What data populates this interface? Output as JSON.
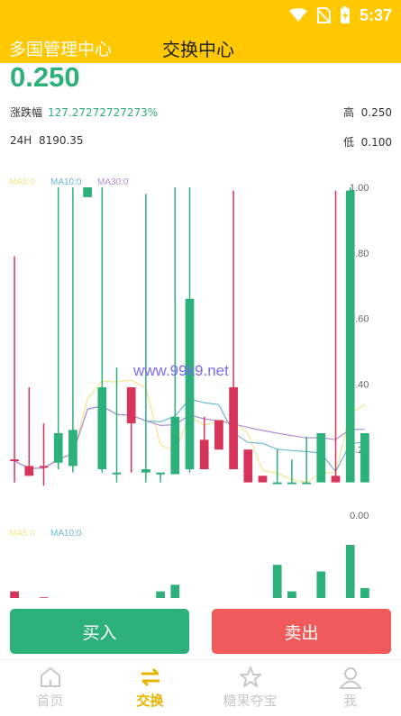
{
  "status_bar": {
    "time": "5:37"
  },
  "app_bar": {
    "left_title": "多国管理中心",
    "center_title": "交换中心"
  },
  "ticker": {
    "price": "0.250",
    "change_label": "涨跌幅",
    "change_value": "127.27272727273%",
    "high_label": "高",
    "high_value": "0.250",
    "volume_label": "24H",
    "volume_value": "8190.35",
    "low_label": "低",
    "low_value": "0.100"
  },
  "colors": {
    "accent": "#FFC800",
    "up": "#2DB07A",
    "down": "#D6345A",
    "sell": "#F05A5A"
  },
  "chart_data": {
    "type": "candlestick",
    "legend_main": [
      "MA5:0",
      "MA10:0",
      "MA30:0"
    ],
    "legend_volume": [
      "MA5:0",
      "MA10:0"
    ],
    "y_ticks": [
      "1.00",
      "0.80",
      "0.60",
      "0.40",
      "0.20",
      "0.00"
    ],
    "ylim": [
      0,
      1.0
    ],
    "watermark": "www.99k9.net",
    "candles": [
      {
        "o": 0.17,
        "c": 0.165,
        "h": 0.79,
        "l": 0.1
      },
      {
        "o": 0.15,
        "c": 0.12,
        "h": 0.39,
        "l": 0.12
      },
      {
        "o": 0.15,
        "c": 0.145,
        "h": 0.28,
        "l": 0.09
      },
      {
        "o": 0.16,
        "c": 0.25,
        "h": 1.0,
        "l": 0.14
      },
      {
        "o": 0.15,
        "c": 0.26,
        "h": 1.0,
        "l": 0.13
      },
      {
        "o": 0.97,
        "c": 1.0,
        "h": 1.0,
        "l": 0.97
      },
      {
        "o": 0.14,
        "c": 0.39,
        "h": 1.0,
        "l": 0.13
      },
      {
        "o": 0.13,
        "c": 0.13,
        "h": 0.45,
        "l": 0.1
      },
      {
        "o": 0.39,
        "c": 0.28,
        "h": 0.39,
        "l": 0.13
      },
      {
        "o": 0.13,
        "c": 0.14,
        "h": 0.98,
        "l": 0.1
      },
      {
        "o": 0.13,
        "c": 0.13,
        "h": 0.13,
        "l": 0.1
      },
      {
        "o": 0.125,
        "c": 0.3,
        "h": 1.0,
        "l": 0.125
      },
      {
        "o": 0.14,
        "c": 0.66,
        "h": 1.0,
        "l": 0.13
      },
      {
        "o": 0.23,
        "c": 0.14,
        "h": 0.3,
        "l": 0.14
      },
      {
        "o": 0.29,
        "c": 0.2,
        "h": 0.29,
        "l": 0.2
      },
      {
        "o": 0.39,
        "c": 0.14,
        "h": 0.99,
        "l": 0.14
      },
      {
        "o": 0.2,
        "c": 0.1,
        "h": 0.2,
        "l": 0.1
      },
      {
        "o": 0.12,
        "c": 0.1,
        "h": 0.12,
        "l": 0.1
      },
      {
        "o": 0.1,
        "c": 0.1,
        "h": 0.2,
        "l": 0.1
      },
      {
        "o": 0.1,
        "c": 0.1,
        "h": 0.17,
        "l": 0.1
      },
      {
        "o": 0.1,
        "c": 0.1,
        "h": 0.24,
        "l": 0.1
      },
      {
        "o": 0.1,
        "c": 0.25,
        "h": 0.25,
        "l": 0.1
      },
      {
        "o": 0.12,
        "c": 0.1,
        "h": 0.99,
        "l": 0.1
      },
      {
        "o": 0.1,
        "c": 0.99,
        "h": 1.0,
        "l": 0.1
      },
      {
        "o": 0.1,
        "c": 0.25,
        "h": 0.25,
        "l": 0.1
      }
    ],
    "volumes": [
      1,
      0,
      0.1,
      0,
      0,
      0,
      0,
      0,
      0,
      0,
      1,
      2,
      0,
      0,
      0,
      0,
      0,
      0,
      5,
      1,
      0,
      4,
      0,
      8,
      1.5
    ]
  },
  "actions": {
    "buy": "买入",
    "sell": "卖出"
  },
  "tabs": [
    {
      "label": "首页",
      "icon": "home-icon"
    },
    {
      "label": "交换",
      "icon": "exchange-icon",
      "active": true
    },
    {
      "label": "糖果夺宝",
      "icon": "star-icon"
    },
    {
      "label": "我",
      "icon": "person-icon"
    }
  ]
}
